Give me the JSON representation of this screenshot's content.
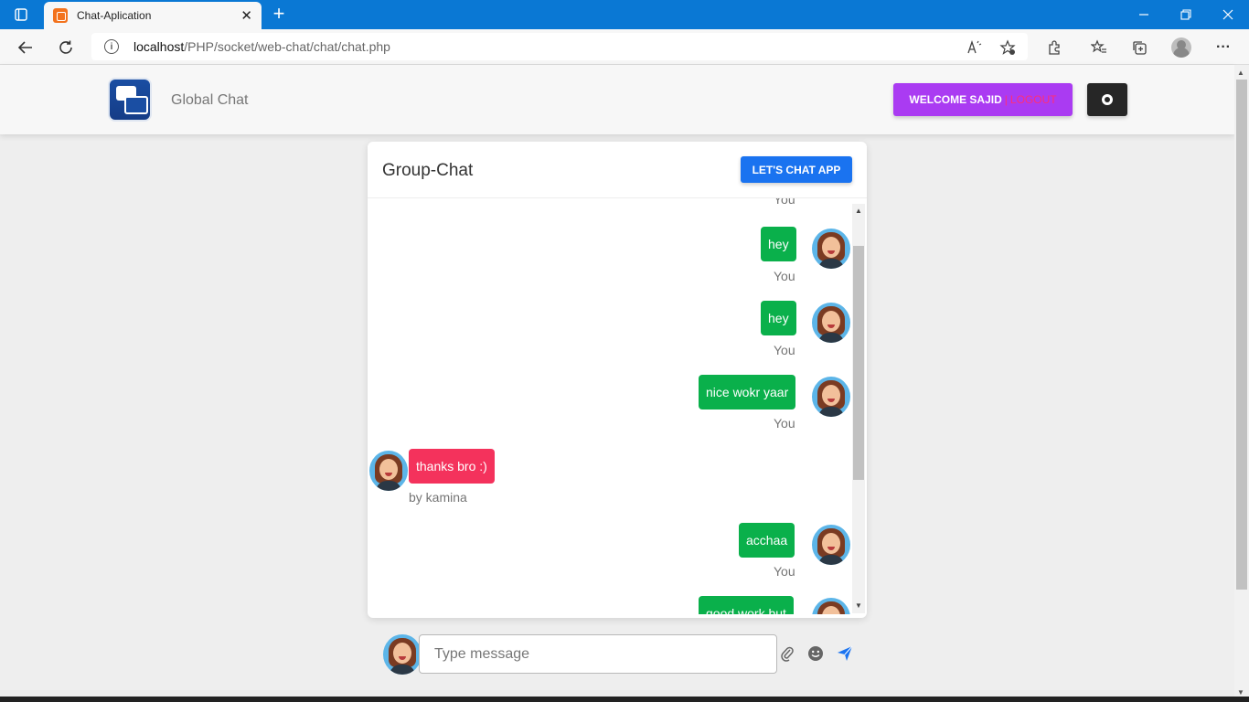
{
  "browser": {
    "tab_title": "Chat-Aplication",
    "tab_close": "✕",
    "new_tab": "+",
    "url_host": "localhost",
    "url_path": "/PHP/socket/web-chat/chat/chat.php",
    "minimize": "—",
    "restore": "❐",
    "close": "✕",
    "more": "···"
  },
  "navbar": {
    "brand": "Global Chat",
    "welcome": "WELCOME SAJID",
    "separator": "|",
    "logout": "LOGOUT"
  },
  "card": {
    "title": "Group-Chat",
    "chat_button": "LET'S CHAT APP"
  },
  "messages": [
    {
      "text": "",
      "meta": "You",
      "sender": "you"
    },
    {
      "text": "hey",
      "meta": "You",
      "sender": "you"
    },
    {
      "text": "hey",
      "meta": "You",
      "sender": "you"
    },
    {
      "text": "nice wokr yaar",
      "meta": "You",
      "sender": "you"
    },
    {
      "text": "thanks bro :)",
      "meta": "by kamina",
      "sender": "other"
    },
    {
      "text": "acchaa",
      "meta": "You",
      "sender": "you"
    },
    {
      "text": "good work but",
      "meta": "",
      "sender": "you"
    }
  ],
  "composer": {
    "placeholder": "Type message"
  },
  "colors": {
    "you_bubble": "#0ab04b",
    "other_bubble": "#f4325c",
    "welcome_button": "#aa3bf2",
    "chat_button": "#1a73f0",
    "titlebar": "#0a78d4"
  }
}
